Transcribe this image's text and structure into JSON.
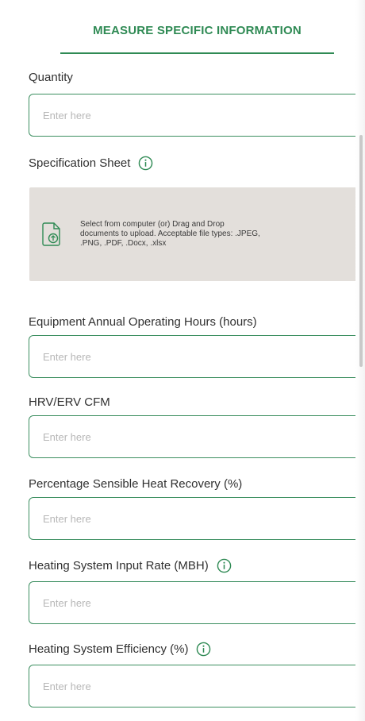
{
  "section": {
    "title": "MEASURE SPECIFIC INFORMATION"
  },
  "fields": {
    "quantity": {
      "label": "Quantity",
      "placeholder": "Enter here",
      "value": ""
    },
    "spec_sheet": {
      "label": "Specification Sheet",
      "info_icon": "info-icon",
      "upload_text": "Select from computer (or) Drag and Drop documents to upload. Acceptable file types: .JPEG, .PNG, .PDF, .Docx, .xlsx",
      "upload_icon": "file-upload-icon"
    },
    "operating_hours": {
      "label": "Equipment Annual Operating Hours (hours)",
      "placeholder": "Enter here",
      "value": ""
    },
    "cfm": {
      "label": "HRV/ERV CFM",
      "placeholder": "Enter here",
      "value": ""
    },
    "heat_recovery": {
      "label": "Percentage Sensible Heat Recovery (%)",
      "placeholder": "Enter here",
      "value": ""
    },
    "input_rate": {
      "label": "Heating System Input Rate (MBH)",
      "info_icon": "info-icon",
      "placeholder": "Enter here",
      "value": ""
    },
    "efficiency": {
      "label": "Heating System Efficiency (%)",
      "info_icon": "info-icon",
      "placeholder": "Enter here",
      "value": ""
    }
  },
  "colors": {
    "accent": "#2f8a54",
    "input_border": "#3c8f60",
    "upload_bg": "#e3dfdb"
  }
}
